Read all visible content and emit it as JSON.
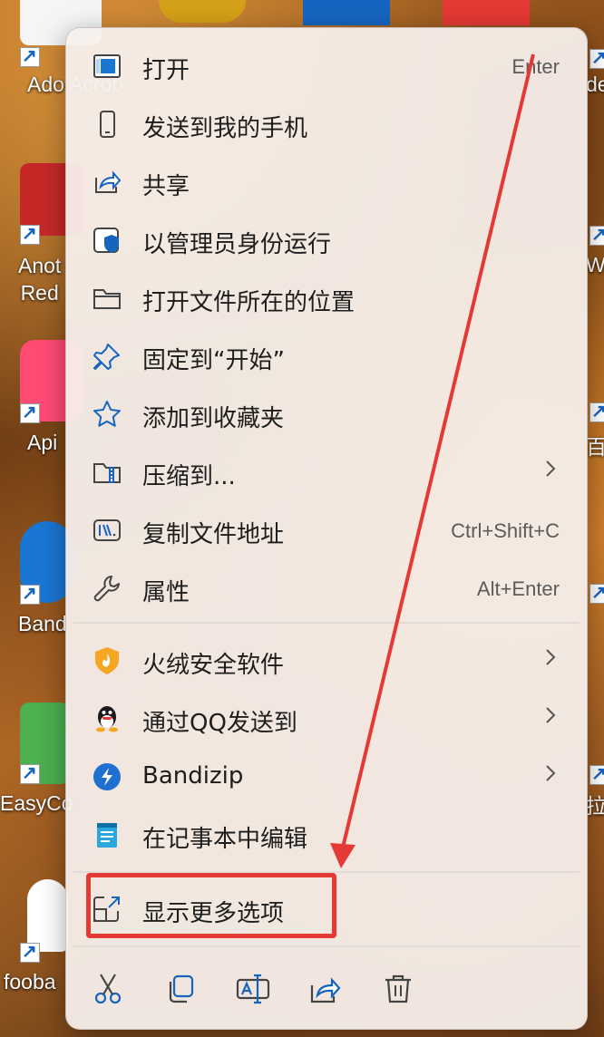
{
  "desktop": {
    "icons": [
      {
        "label": "Ado\nAcrob",
        "color": "#f1f1f1"
      },
      {
        "label": "Anot\nRed",
        "color": "#c62828"
      },
      {
        "label": "Api",
        "color": "#ff4a74"
      },
      {
        "label": "Band",
        "color": "#1976d2"
      },
      {
        "label": "EasyCo",
        "color": "#4caf50"
      },
      {
        "label": "fooba",
        "color": "#ffffff"
      }
    ],
    "right_icon_labels": [
      "de",
      "Wir",
      "百",
      "拉"
    ]
  },
  "context_menu": {
    "items": [
      {
        "label": "打开",
        "shortcut": "Enter",
        "icon": "open-window-icon"
      },
      {
        "label": "发送到我的手机",
        "shortcut": "",
        "icon": "phone-icon"
      },
      {
        "label": "共享",
        "shortcut": "",
        "icon": "share-icon"
      },
      {
        "label": "以管理员身份运行",
        "shortcut": "",
        "icon": "admin-shield-icon"
      },
      {
        "label": "打开文件所在的位置",
        "shortcut": "",
        "icon": "folder-icon"
      },
      {
        "label": "固定到“开始”",
        "shortcut": "",
        "icon": "pin-icon"
      },
      {
        "label": "添加到收藏夹",
        "shortcut": "",
        "icon": "star-icon"
      },
      {
        "label": "压缩到...",
        "shortcut": "",
        "icon": "zip-folder-icon",
        "submenu": true
      },
      {
        "label": "复制文件地址",
        "shortcut": "Ctrl+Shift+C",
        "icon": "copy-path-icon"
      },
      {
        "label": "属性",
        "shortcut": "Alt+Enter",
        "icon": "wrench-icon"
      }
    ],
    "third_party_items": [
      {
        "label": "火绒安全软件",
        "icon": "huorong-icon",
        "submenu": true
      },
      {
        "label": "通过QQ发送到",
        "icon": "qq-penguin-icon",
        "submenu": true
      },
      {
        "label": "Bandizip",
        "icon": "bandizip-icon",
        "submenu": true
      },
      {
        "label": "在记事本中编辑",
        "icon": "notepad-icon",
        "submenu": false
      }
    ],
    "more_options": {
      "label": "显示更多选项",
      "icon": "more-options-icon"
    },
    "bottom_actions": [
      {
        "name": "cut",
        "icon": "scissors-icon"
      },
      {
        "name": "copy",
        "icon": "copy-icon"
      },
      {
        "name": "rename",
        "icon": "rename-icon"
      },
      {
        "name": "share",
        "icon": "share-icon"
      },
      {
        "name": "delete",
        "icon": "trash-icon"
      }
    ]
  },
  "colors": {
    "accent": "#0a66c8",
    "annotation_red": "#e53935",
    "menu_bg": "#f6f0ec"
  }
}
